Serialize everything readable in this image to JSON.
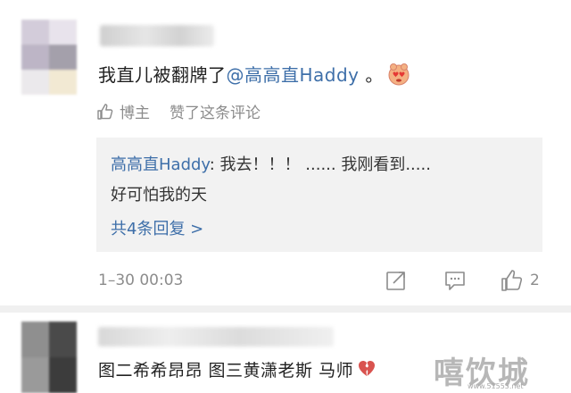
{
  "comment": {
    "text_before": "我直儿被翻牌了",
    "mention": "@高高直Haddy",
    "text_after": " 。",
    "emoji": "heart-eyes-emoji"
  },
  "liked_by": {
    "author": "博主",
    "action": "赞了这条评论"
  },
  "reply": {
    "name": "高高直Haddy",
    "text1": ": 我去！！！ ...... 我刚看到.....",
    "text2": "好可怕我的天",
    "more": "共4条回复 >"
  },
  "meta": {
    "time": "1–30 00:03",
    "like_count": "2"
  },
  "comment2": {
    "text": "图二希希昂昂 图三黄潇老斯 马师"
  },
  "watermark": {
    "text": "嘻饮城",
    "url": "www.51555.net"
  },
  "colors": {
    "link": "#3e6fa9",
    "gray": "#8c8c8c",
    "reply_bg": "#f2f2f2"
  }
}
